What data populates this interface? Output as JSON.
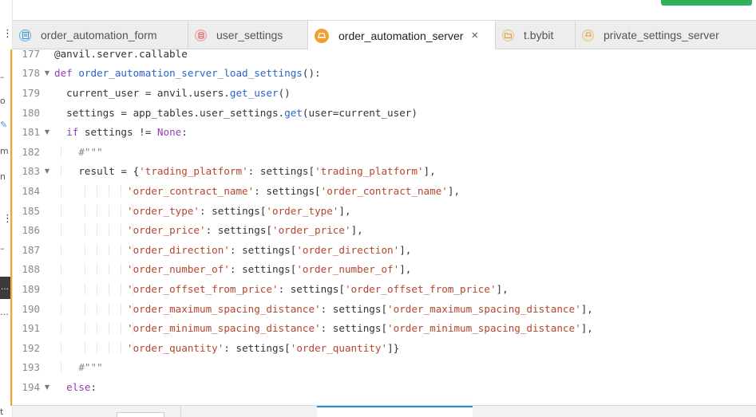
{
  "rail": {
    "items": [
      "o",
      "m",
      "n"
    ],
    "top_partial": "t"
  },
  "tabs": [
    {
      "label": "order_automation_form",
      "icon": "form-icon",
      "color": "#6aaed6",
      "active": false
    },
    {
      "label": "user_settings",
      "icon": "database-icon",
      "color": "#e89a9a",
      "active": false
    },
    {
      "label": "order_automation_server",
      "icon": "server-module-icon",
      "color": "#f0a033",
      "active": true,
      "close": "×"
    },
    {
      "label": "t.bybit",
      "icon": "folder-icon",
      "color": "#e3c28e",
      "active": false
    },
    {
      "label": "private_settings_server",
      "icon": "server-module-icon",
      "color": "#e3c28e",
      "active": false
    }
  ],
  "editor": {
    "lines": [
      {
        "n": "177",
        "fold": ""
      },
      {
        "n": "178",
        "fold": "▼"
      },
      {
        "n": "179",
        "fold": ""
      },
      {
        "n": "180",
        "fold": ""
      },
      {
        "n": "181",
        "fold": "▼"
      },
      {
        "n": "182",
        "fold": ""
      },
      {
        "n": "183",
        "fold": "▼"
      },
      {
        "n": "184",
        "fold": ""
      },
      {
        "n": "185",
        "fold": ""
      },
      {
        "n": "186",
        "fold": ""
      },
      {
        "n": "187",
        "fold": ""
      },
      {
        "n": "188",
        "fold": ""
      },
      {
        "n": "189",
        "fold": ""
      },
      {
        "n": "190",
        "fold": ""
      },
      {
        "n": "191",
        "fold": ""
      },
      {
        "n": "192",
        "fold": ""
      },
      {
        "n": "193",
        "fold": ""
      },
      {
        "n": "194",
        "fold": "▼"
      }
    ],
    "tokens": {
      "l177": "@anvil.server.callable",
      "l178_kw": "def",
      "l178_fn": "order_automation_server_load_settings",
      "l178_rest": "():",
      "l179_a": "current_user = anvil.users.",
      "l179_fn": "get_user",
      "l179_b": "()",
      "l180_a": "settings = app_tables.user_settings.",
      "l180_fn": "get",
      "l180_b": "(user=current_user)",
      "l181_kw": "if",
      "l181_a": " settings != ",
      "l181_none": "None",
      "l181_b": ":",
      "l182": "#\"\"\"",
      "l183_a": "result = {",
      "l183_k": "'trading_platform'",
      "l183_b": ": settings[",
      "l183_v": "'trading_platform'",
      "l183_c": "],",
      "rows": [
        {
          "k": "'order_contract_name'",
          "v": "'order_contract_name'",
          "end": "],"
        },
        {
          "k": "'order_type'",
          "v": "'order_type'",
          "end": "],"
        },
        {
          "k": "'order_price'",
          "v": "'order_price'",
          "end": "],"
        },
        {
          "k": "'order_direction'",
          "v": "'order_direction'",
          "end": "],"
        },
        {
          "k": "'order_number_of'",
          "v": "'order_number_of'",
          "end": "],"
        },
        {
          "k": "'order_offset_from_price'",
          "v": "'order_offset_from_price'",
          "end": "],"
        },
        {
          "k": "'order_maximum_spacing_distance'",
          "v": "'order_maximum_spacing_distance'",
          "end": "],"
        },
        {
          "k": "'order_minimum_spacing_distance'",
          "v": "'order_minimum_spacing_distance'",
          "end": "],"
        },
        {
          "k": "'order_quantity'",
          "v": "'order_quantity'",
          "end": "]}"
        }
      ],
      "row_mid": ": settings[",
      "l193": "#\"\"\"",
      "l194_kw": "else",
      "l194_b": ":"
    }
  },
  "colors": {
    "keyword": "#8b3fb0",
    "function": "#2a63c9",
    "string": "#b5452f",
    "accent_orange": "#f5a623",
    "green_button": "#2fb25a"
  }
}
